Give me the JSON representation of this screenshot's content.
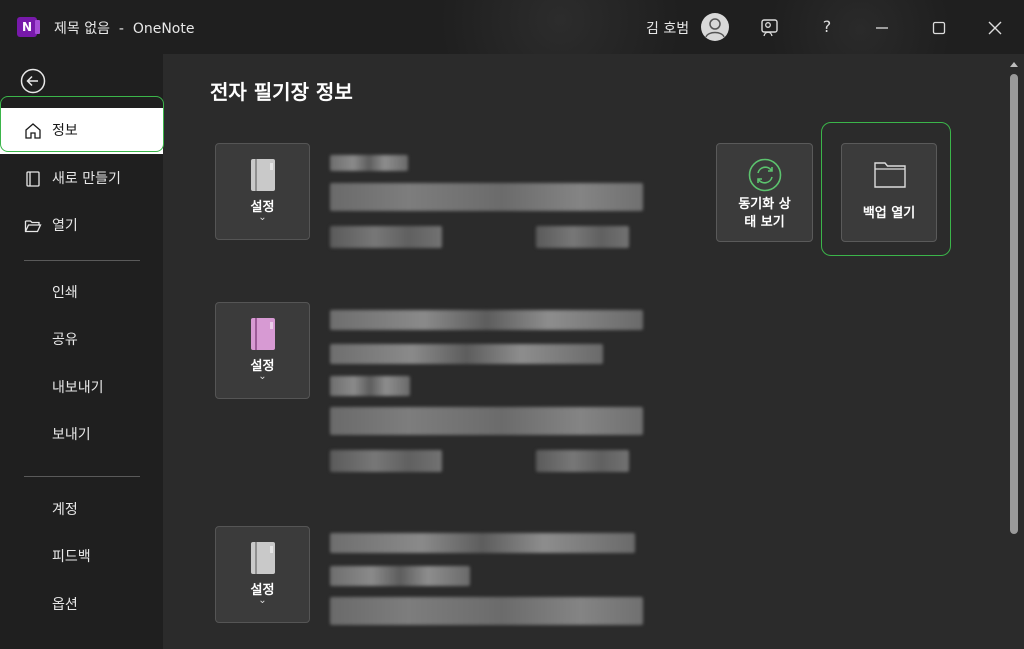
{
  "window": {
    "title": "제목 없음  -  OneNote",
    "app_icon_letter": "N",
    "user_name": "김 호범",
    "help_label": "?"
  },
  "sidebar": {
    "items": [
      {
        "label": "정보",
        "icon": "home-icon",
        "selected": true
      },
      {
        "label": "새로 만들기",
        "icon": "new-document-icon"
      },
      {
        "label": "열기",
        "icon": "folder-open-icon"
      },
      {
        "label": "인쇄"
      },
      {
        "label": "공유"
      },
      {
        "label": "내보내기"
      },
      {
        "label": "보내기"
      },
      {
        "label": "계정"
      },
      {
        "label": "피드백"
      },
      {
        "label": "옵션"
      }
    ]
  },
  "main": {
    "title": "전자 필기장 정보",
    "notebooks": [
      {
        "settings_label": "설정",
        "chevron": "⌄",
        "color": "#c9c9c9"
      },
      {
        "settings_label": "설정",
        "chevron": "⌄",
        "color": "#d79ad3"
      },
      {
        "settings_label": "설정",
        "chevron": "⌄",
        "color": "#c9c9c9"
      }
    ],
    "actions": {
      "sync_status": "동기화 상\n태 보기",
      "open_backup": "백업 열기"
    }
  },
  "colors": {
    "accent_outline": "#3bb54a",
    "sync_icon": "#5cc36e",
    "onenote_purple": "#7719aa"
  }
}
